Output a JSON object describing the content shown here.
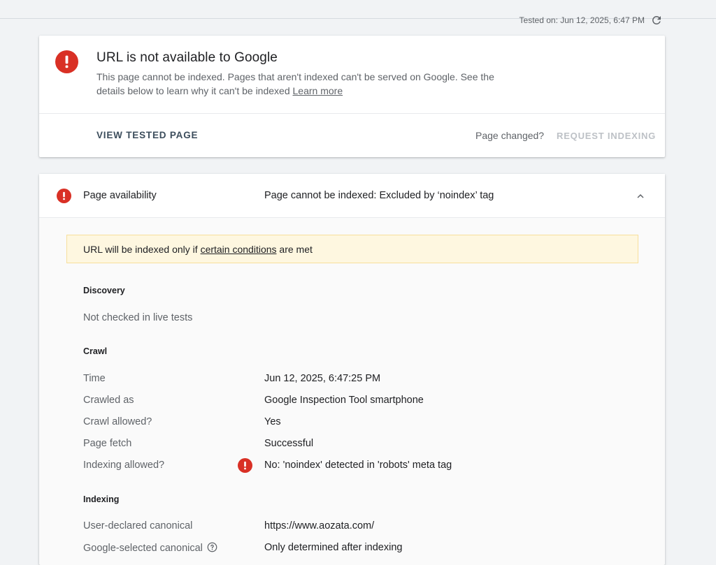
{
  "header": {
    "tested_on": "Tested on: Jun 12, 2025, 6:47 PM",
    "refresh_icon": "refresh-icon"
  },
  "status_card": {
    "title": "URL is not available to Google",
    "description": "This page cannot be indexed. Pages that aren't indexed can't be served on Google. See the details below to learn why it can't be indexed",
    "learn_more": "Learn more",
    "view_tested_page": "VIEW TESTED PAGE",
    "page_changed": "Page changed?",
    "request_indexing": "REQUEST INDEXING",
    "icon": "error-icon"
  },
  "availability": {
    "label": "Page availability",
    "value": "Page cannot be indexed: Excluded by ‘noindex’ tag",
    "notice_prefix": "URL will be indexed only if ",
    "notice_link": "certain conditions",
    "notice_suffix": " are met"
  },
  "discovery": {
    "heading": "Discovery",
    "note": "Not checked in live tests"
  },
  "crawl": {
    "heading": "Crawl",
    "rows": [
      {
        "label": "Time",
        "value": "Jun 12, 2025, 6:47:25 PM"
      },
      {
        "label": "Crawled as",
        "value": "Google Inspection Tool smartphone"
      },
      {
        "label": "Crawl allowed?",
        "value": "Yes"
      },
      {
        "label": "Page fetch",
        "value": "Successful"
      },
      {
        "label": "Indexing allowed?",
        "value": "No: 'noindex' detected in 'robots' meta tag"
      }
    ]
  },
  "indexing": {
    "heading": "Indexing",
    "rows": [
      {
        "label": "User-declared canonical",
        "value": "https://www.aozata.com/"
      },
      {
        "label": "Google-selected canonical",
        "value": "Only determined after indexing"
      }
    ]
  },
  "colors": {
    "error": "#d93025",
    "notice_bg": "#fef7e0",
    "notice_border": "#f7df9c",
    "disabled_text": "#bdc1c6"
  }
}
